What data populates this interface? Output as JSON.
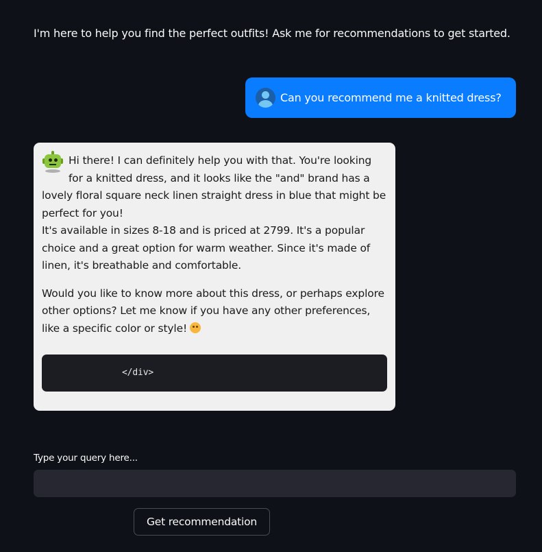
{
  "intro_text": "I'm here to help you find the perfect outfits! Ask me for recommendations to get started.",
  "user_message": {
    "avatar_icon": "user-avatar-icon",
    "text": "Can you recommend me a knitted dress?"
  },
  "assistant_message": {
    "avatar_icon": "robot-icon",
    "paragraph_1_line_1": "Hi there! I can definitely help you with that. You're looking for a knitted dress, and it looks like the \"and\" brand has a lovely floral square neck linen straight dress in blue that might be perfect for you!",
    "paragraph_1_line_2": "It's available in sizes 8-18 and is priced at 2799. It's a popular choice and a great option for warm weather. Since it's made of linen, it's breathable and comfortable.",
    "paragraph_2": "Would you like to know more about this dress, or perhaps explore other options? Let me know if you have any other preferences, like a specific color or style!",
    "emoji_icon": "smiling-face-icon",
    "code": "</div>"
  },
  "query": {
    "label": "Type your query here...",
    "value": ""
  },
  "button_label": "Get recommendation",
  "colors": {
    "background": "#0e1117",
    "user_bubble": "#0a7cff",
    "assistant_bubble": "#f0f0f0",
    "code_block": "#1c1d23",
    "input_background": "#262730"
  }
}
